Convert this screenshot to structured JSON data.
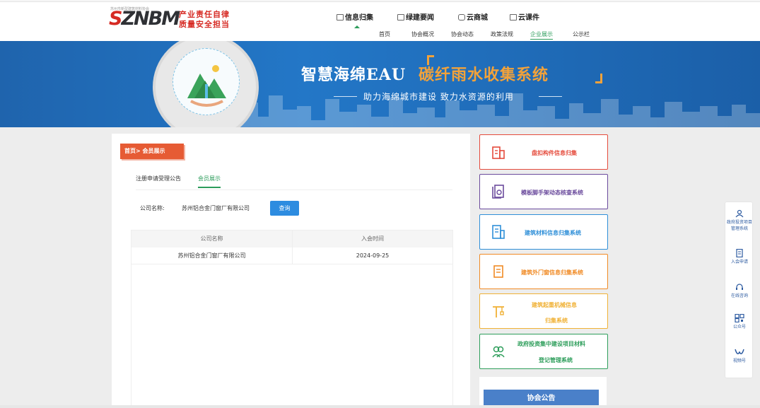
{
  "header": {
    "logo_text": "SZNBM",
    "logo_tiny": "苏州市新型建筑材料协会",
    "slogan_line1": "产业责任自律",
    "slogan_line2": "质量安全担当",
    "main_nav": [
      {
        "label": "信息归集"
      },
      {
        "label": "绿建要闻"
      },
      {
        "label": "云商城"
      },
      {
        "label": "云课件"
      }
    ],
    "sub_nav": [
      {
        "label": "首页"
      },
      {
        "label": "协会概况"
      },
      {
        "label": "协会动态"
      },
      {
        "label": "政策法规"
      },
      {
        "label": "企业展示"
      },
      {
        "label": "公示栏"
      }
    ],
    "accent_color": "#2c9c5b"
  },
  "banner": {
    "title_prefix": "智慧海绵EAU",
    "title_highlight": "碳纤雨水收集系统",
    "subtitle": "助力海绵城市建设  致力水资源的利用",
    "highlight_color": "#f2a23a"
  },
  "main": {
    "breadcrumb": "首页> 会员展示",
    "tabs": [
      {
        "label": "注册申请受理公告"
      },
      {
        "label": "会员展示"
      }
    ],
    "search": {
      "label": "公司名称:",
      "value": "苏州铝合金门窗厂有限公司",
      "button": "查询"
    },
    "table": {
      "headers": [
        "公司名称",
        "入会时间"
      ],
      "rows": [
        [
          "苏州铝合金门窗厂有限公司",
          "2024-09-25"
        ]
      ]
    }
  },
  "sidebar": {
    "items": [
      {
        "line1": "盘扣构件信息归集",
        "line2": "",
        "color": "#e54b3c",
        "icon": "building-icon"
      },
      {
        "line1": "模板脚手架动态核查系统",
        "line2": "",
        "color": "#6a4a9c",
        "icon": "scaffold-search-icon"
      },
      {
        "line1": "建筑材料信息归集系统",
        "line2": "",
        "color": "#2f8fd8",
        "icon": "materials-building-icon"
      },
      {
        "line1": "建筑外门窗信息归集系统",
        "line2": "",
        "color": "#f08a24",
        "icon": "window-icon"
      },
      {
        "line1": "建筑起重机械信息",
        "line2": "归集系统",
        "color": "#f0b135",
        "icon": "crane-icon"
      },
      {
        "line1": "政府投资集中建设项目材料",
        "line2": "登记管理系统",
        "color": "#2e9e5b",
        "icon": "people-icon"
      }
    ],
    "notice_button": "协会公告"
  },
  "float_bar": {
    "items": [
      {
        "label": "政府投资项目管理系统",
        "icon": "user-group-icon"
      },
      {
        "label": "入会申请",
        "icon": "document-icon"
      },
      {
        "label": "在线咨询",
        "icon": "headset-icon"
      },
      {
        "label": "公众号",
        "icon": "qrcode-icon"
      },
      {
        "label": "视频号",
        "icon": "video-channel-icon"
      }
    ]
  }
}
